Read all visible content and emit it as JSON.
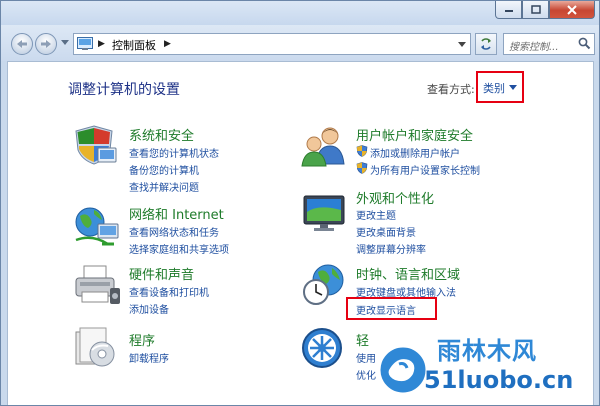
{
  "address": {
    "path": "控制面板",
    "search_placeholder": "搜索控制..."
  },
  "header": {
    "title": "调整计算机的设置",
    "view_by_label": "查看方式:",
    "view_by_value": "类别"
  },
  "categories": [
    {
      "title": "系统和安全",
      "icon": "system-security-icon",
      "links": [
        "查看您的计算机状态",
        "备份您的计算机",
        "查找并解决问题"
      ]
    },
    {
      "title": "网络和 Internet",
      "icon": "network-icon",
      "links": [
        "查看网络状态和任务",
        "选择家庭组和共享选项"
      ]
    },
    {
      "title": "硬件和声音",
      "icon": "printer-icon",
      "links": [
        "查看设备和打印机",
        "添加设备"
      ]
    },
    {
      "title": "程序",
      "icon": "programs-icon",
      "links": [
        "卸载程序"
      ]
    },
    {
      "title": "用户帐户和家庭安全",
      "icon": "users-icon",
      "links": [
        "添加或删除用户帐户",
        "为所有用户设置家长控制"
      ]
    },
    {
      "title": "外观和个性化",
      "icon": "monitor-icon",
      "links": [
        "更改主题",
        "更改桌面背景",
        "调整屏幕分辨率"
      ]
    },
    {
      "title": "时钟、语言和区域",
      "icon": "clock-globe-icon",
      "links": [
        "更改键盘或其他输入法",
        "更改显示语言"
      ]
    },
    {
      "title": "轻",
      "icon": "ease-of-access-icon",
      "links": [
        "使用",
        "优化"
      ]
    }
  ],
  "watermark": {
    "top": "雨林木风",
    "bottom": "51luobo.cn"
  },
  "colors": {
    "category_title": "#1e7b2a",
    "link": "#1f4fa0",
    "highlight": "#e60012"
  }
}
